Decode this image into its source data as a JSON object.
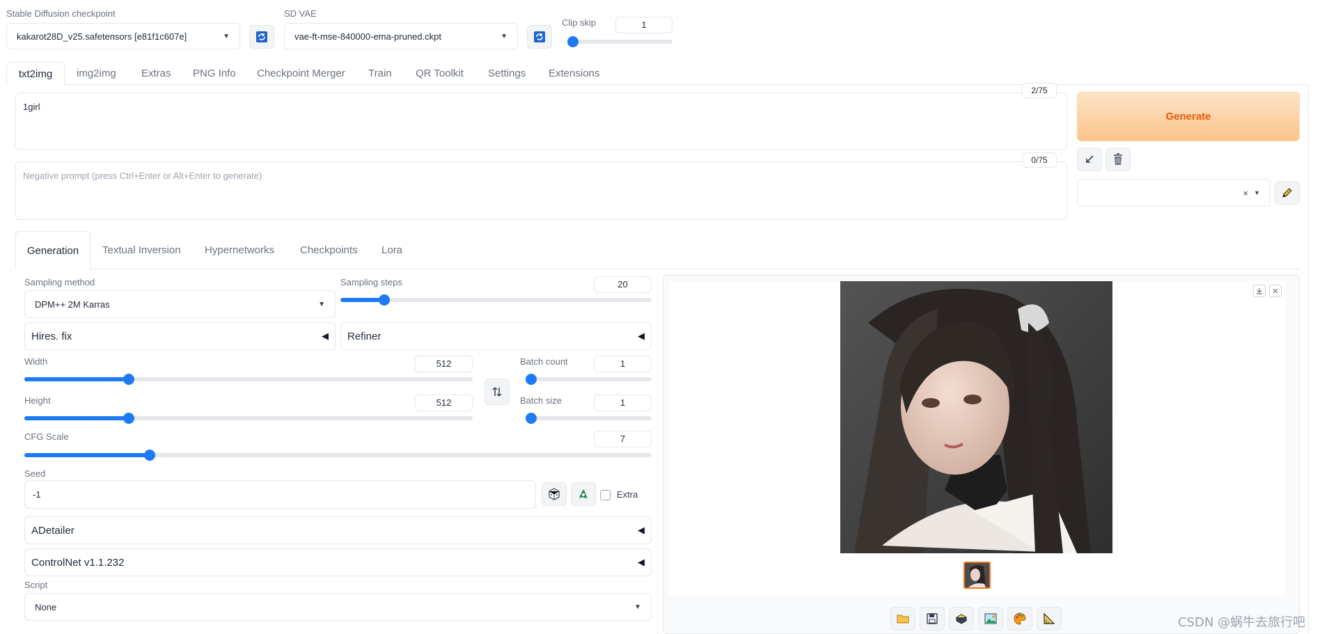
{
  "top": {
    "checkpoint_label": "Stable Diffusion checkpoint",
    "checkpoint_value": "kakarot28D_v25.safetensors [e81f1c607e]",
    "vae_label": "SD VAE",
    "vae_value": "vae-ft-mse-840000-ema-pruned.ckpt",
    "clip_skip_label": "Clip skip",
    "clip_skip_value": "1"
  },
  "main_tabs": [
    "txt2img",
    "img2img",
    "Extras",
    "PNG Info",
    "Checkpoint Merger",
    "Train",
    "QR Toolkit",
    "Settings",
    "Extensions"
  ],
  "prompt": {
    "text": "1girl",
    "token_count": "2/75",
    "negative_placeholder": "Negative prompt (press Ctrl+Enter or Alt+Enter to generate)",
    "negative_token_count": "0/75"
  },
  "generate_label": "Generate",
  "style_clear": "×",
  "sub_tabs": [
    "Generation",
    "Textual Inversion",
    "Hypernetworks",
    "Checkpoints",
    "Lora"
  ],
  "generation": {
    "sampling_method_label": "Sampling method",
    "sampling_method_value": "DPM++ 2M Karras",
    "sampling_steps_label": "Sampling steps",
    "sampling_steps_value": "20",
    "hires_label": "Hires. fix",
    "refiner_label": "Refiner",
    "width_label": "Width",
    "width_value": "512",
    "height_label": "Height",
    "height_value": "512",
    "batch_count_label": "Batch count",
    "batch_count_value": "1",
    "batch_size_label": "Batch size",
    "batch_size_value": "1",
    "cfg_label": "CFG Scale",
    "cfg_value": "7",
    "seed_label": "Seed",
    "seed_value": "-1",
    "extra_label": "Extra",
    "adetailer_label": "ADetailer",
    "controlnet_label": "ControlNet v1.1.232",
    "script_label": "Script",
    "script_value": "None"
  },
  "sliders": {
    "clip_skip": 0.0,
    "sampling_steps": 0.14,
    "width": 0.233,
    "height": 0.233,
    "batch_count": 0.0,
    "batch_size": 0.0,
    "cfg": 0.2
  },
  "watermark": "CSDN @蜗牛去旅行吧",
  "colors": {
    "accent": "#1d7af3",
    "generate_from": "#fde0c2",
    "generate_to": "#fbbf80",
    "generate_text": "#ea580c",
    "thumb_border": "#f97316"
  },
  "icons": [
    "refresh-icon",
    "send-to-icon",
    "trash-icon",
    "pencil-icon",
    "swap-icon",
    "dice-icon",
    "recycle-icon",
    "download-icon",
    "close-icon",
    "folder-icon",
    "save-icon",
    "zip-icon",
    "image-icon",
    "palette-icon",
    "ruler-icon"
  ]
}
